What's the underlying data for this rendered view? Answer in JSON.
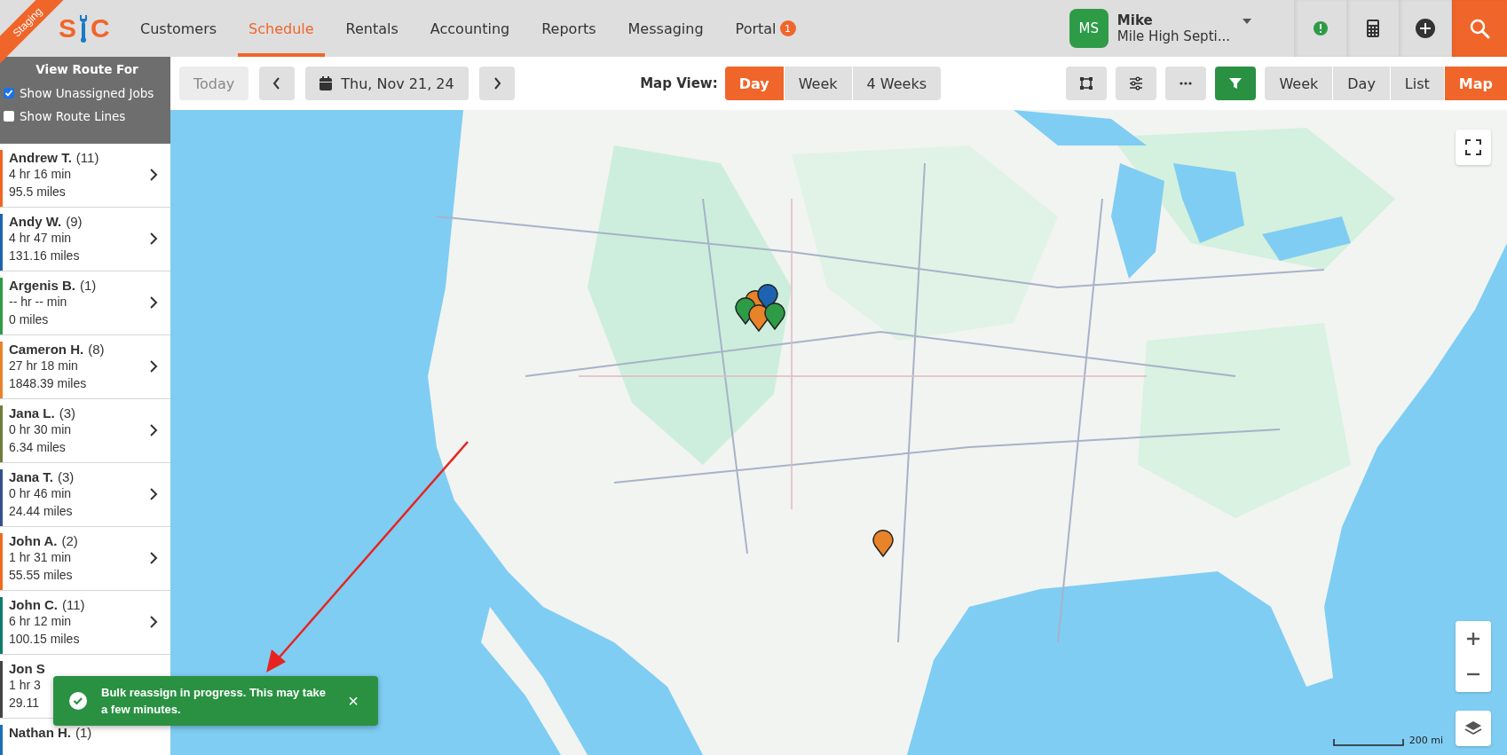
{
  "header": {
    "environment_ribbon": "Staging",
    "logo_letters": [
      "S",
      "C"
    ],
    "nav": [
      {
        "label": "Customers",
        "selected": false
      },
      {
        "label": "Schedule",
        "selected": true
      },
      {
        "label": "Rentals",
        "selected": false
      },
      {
        "label": "Accounting",
        "selected": false
      },
      {
        "label": "Reports",
        "selected": false
      },
      {
        "label": "Messaging",
        "selected": false
      },
      {
        "label": "Portal",
        "selected": false,
        "badge": "1"
      }
    ],
    "user": {
      "initials": "MS",
      "name": "Mike",
      "company": "Mile High Septi..."
    }
  },
  "sidebar": {
    "title": "View Route For",
    "options": [
      {
        "label": "Show Unassigned Jobs",
        "checked": true
      },
      {
        "label": "Show Route Lines",
        "checked": false
      }
    ],
    "routes": [
      {
        "name": "Andrew T.",
        "count": "(11)",
        "time": "4 hr 16 min",
        "distance": "95.5 miles",
        "color": "#f26522"
      },
      {
        "name": "Andy W.",
        "count": "(9)",
        "time": "4 hr 47 min",
        "distance": "131.16 miles",
        "color": "#1e63b0"
      },
      {
        "name": "Argenis B.",
        "count": "(1)",
        "time": "-- hr -- min",
        "distance": "0 miles",
        "color": "#2e9b47"
      },
      {
        "name": "Cameron H.",
        "count": "(8)",
        "time": "27 hr 18 min",
        "distance": "1848.39 miles",
        "color": "#e8832a"
      },
      {
        "name": "Jana L.",
        "count": "(3)",
        "time": "0 hr 30 min",
        "distance": "6.34 miles",
        "color": "#6e7d3a"
      },
      {
        "name": "Jana T.",
        "count": "(3)",
        "time": "0 hr 46 min",
        "distance": "24.44 miles",
        "color": "#34508f"
      },
      {
        "name": "John A.",
        "count": "(2)",
        "time": "1 hr 31 min",
        "distance": "55.55 miles",
        "color": "#f06a1e"
      },
      {
        "name": "John C.",
        "count": "(11)",
        "time": "6 hr 12 min",
        "distance": "100.15 miles",
        "color": "#0e7c6b"
      },
      {
        "name": "Jon S",
        "time": "1 hr 3",
        "distance": "29.11",
        "color": "#444444"
      },
      {
        "name": "Nathan H.",
        "count": "(1)",
        "color": "#1a6fb5"
      }
    ]
  },
  "toolbar": {
    "today": {
      "label": "Today",
      "disabled": true
    },
    "date": "Thu, Nov 21, 24",
    "map_view_label": "Map View:",
    "map_view": [
      {
        "label": "Day",
        "selected": true
      },
      {
        "label": "Week",
        "selected": false
      },
      {
        "label": "4 Weeks",
        "selected": false
      }
    ],
    "views": [
      {
        "label": "Week",
        "selected": false
      },
      {
        "label": "Day",
        "selected": false
      },
      {
        "label": "List",
        "selected": false
      },
      {
        "label": "Map",
        "selected": true
      }
    ]
  },
  "map": {
    "kind": "picture",
    "pins": [
      {
        "color": "#e8832a"
      },
      {
        "color": "#1e63b0"
      },
      {
        "color": "#2e9b47"
      },
      {
        "color": "#e8832a"
      },
      {
        "color": "#2e9b47"
      },
      {
        "color": "#e8832a"
      }
    ],
    "scale": "200 mi"
  },
  "toast": {
    "message": "Bulk reassign in progress. This may take a few minutes.",
    "close": "×"
  }
}
